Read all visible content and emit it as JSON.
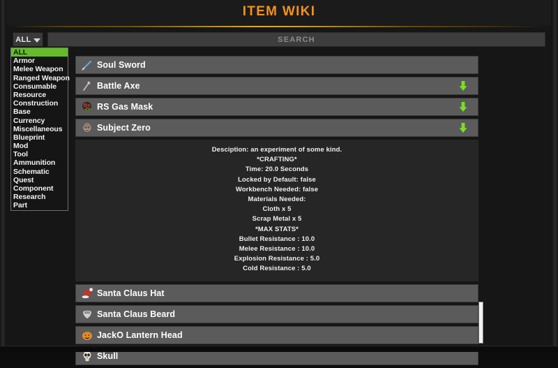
{
  "window": {
    "title": "ITEM WIKI",
    "title_color": "#f49316",
    "accent_rule_color": "#e8b728"
  },
  "toolbar": {
    "category_button_label": "ALL",
    "category_chevron_icon": "chevron-down-icon",
    "search_placeholder": "SEARCH",
    "search_value": ""
  },
  "category_dropdown": {
    "selected": "ALL",
    "highlight_color": "#65bc2a",
    "items": [
      "ALL",
      "Armor",
      "Melee Weapon",
      "Ranged Weapon",
      "Consumable",
      "Resource",
      "Construction",
      "Base",
      "Currency",
      "Miscellaneous",
      "Blueprint",
      "Mod",
      "Tool",
      "Ammunition",
      "Schematic",
      "Quest",
      "Component",
      "Research",
      "Part"
    ]
  },
  "items": [
    {
      "name": "Soul Sword",
      "icon": "sword-icon",
      "expandable": false,
      "expanded": false
    },
    {
      "name": "Battle Axe",
      "icon": "axe-icon",
      "expandable": true,
      "expanded": false
    },
    {
      "name": "RS Gas Mask",
      "icon": "gas-mask-icon",
      "expandable": true,
      "expanded": false
    },
    {
      "name": "Subject Zero",
      "icon": "head-icon",
      "expandable": true,
      "expanded": true
    },
    {
      "name": "Santa Claus Hat",
      "icon": "santa-hat-icon",
      "expandable": false,
      "expanded": false
    },
    {
      "name": "Santa Claus Beard",
      "icon": "beard-icon",
      "expandable": false,
      "expanded": false
    },
    {
      "name": "JackO Lantern Head",
      "icon": "pumpkin-icon",
      "expandable": false,
      "expanded": false
    },
    {
      "name": "Skull",
      "icon": "skull-icon",
      "expandable": false,
      "expanded": false
    }
  ],
  "expanded_details": {
    "for_item": "Subject Zero",
    "lines": [
      "Desciption: an experiment of some kind.",
      "*CRAFTING*",
      "Time: 20.0 Seconds",
      "Locked by Default: false",
      "Workbench Needed: false",
      "Materials Needed:",
      "Cloth x 5",
      "Scrap Metal x 5",
      "*MAX STATS*",
      "Bullet Resistance : 10.0",
      "Melee Resistance : 10.0",
      "Explosion Resistance : 5.0",
      "Cold Resistance : 5.0"
    ]
  },
  "scrollbar": {
    "icon": "vertical-scrollbar",
    "thumb_color": "#f3f3f3"
  },
  "colors": {
    "expand_arrow": "#76e021",
    "row_bg": "#5b5b5b",
    "panel_bg": "#262626",
    "background": "#161616"
  }
}
